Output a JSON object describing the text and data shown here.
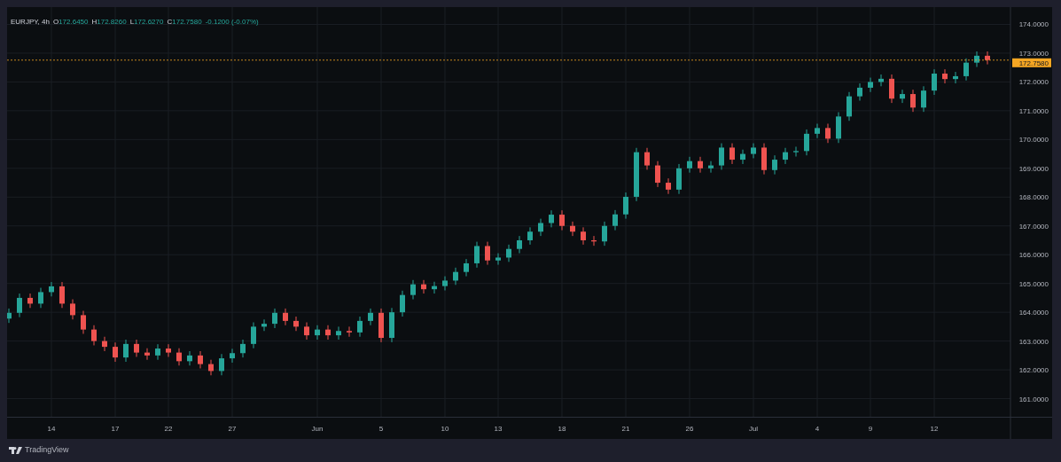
{
  "legend": {
    "symbol": "EURJPY, 4h",
    "ohlc": [
      {
        "label": "O",
        "value": "172.6450"
      },
      {
        "label": "H",
        "value": "172.8260"
      },
      {
        "label": "L",
        "value": "172.6270"
      },
      {
        "label": "C",
        "value": "172.7580"
      }
    ],
    "change": "-0.1200 (-0.07%)"
  },
  "chart": {
    "chart_data": {
      "type": "candlestick",
      "categories": [
        null,
        null,
        null,
        null,
        "14",
        null,
        null,
        null,
        null,
        null,
        "17",
        null,
        null,
        null,
        null,
        "22",
        null,
        null,
        null,
        null,
        null,
        "27",
        null,
        null,
        null,
        null,
        null,
        null,
        null,
        "Jun",
        null,
        null,
        null,
        null,
        null,
        "5",
        null,
        null,
        null,
        null,
        null,
        "10",
        null,
        null,
        null,
        null,
        "13",
        null,
        null,
        null,
        null,
        null,
        "18",
        null,
        null,
        null,
        null,
        null,
        "21",
        null,
        null,
        null,
        null,
        null,
        "26",
        null,
        null,
        null,
        null,
        null,
        "Jul",
        null,
        null,
        null,
        null,
        null,
        "4",
        null,
        null,
        null,
        null,
        "9",
        null,
        null,
        null,
        null,
        null,
        "12",
        null,
        null,
        null,
        null,
        null
      ],
      "ohlc": [
        [
          163.78,
          164.13,
          163.63,
          163.98
        ],
        [
          163.98,
          164.65,
          163.83,
          164.5
        ],
        [
          164.5,
          164.65,
          164.15,
          164.3
        ],
        [
          164.3,
          164.85,
          164.15,
          164.7
        ],
        [
          164.7,
          165.05,
          164.55,
          164.9
        ],
        [
          164.9,
          165.05,
          164.15,
          164.3
        ],
        [
          164.3,
          164.45,
          163.75,
          163.9
        ],
        [
          163.9,
          164.05,
          163.25,
          163.4
        ],
        [
          163.4,
          163.55,
          162.85,
          163.0
        ],
        [
          163.0,
          163.15,
          162.65,
          162.8
        ],
        [
          162.8,
          162.95,
          162.28,
          162.43
        ],
        [
          162.43,
          163.05,
          162.28,
          162.9
        ],
        [
          162.9,
          163.05,
          162.45,
          162.6
        ],
        [
          162.6,
          162.75,
          162.35,
          162.5
        ],
        [
          162.5,
          162.89,
          162.35,
          162.74
        ],
        [
          162.74,
          162.89,
          162.45,
          162.6
        ],
        [
          162.6,
          162.75,
          162.15,
          162.3
        ],
        [
          162.3,
          162.65,
          162.15,
          162.5
        ],
        [
          162.5,
          162.65,
          162.05,
          162.2
        ],
        [
          162.2,
          162.35,
          161.81,
          161.96
        ],
        [
          161.96,
          162.55,
          161.81,
          162.4
        ],
        [
          162.4,
          162.73,
          162.25,
          162.58
        ],
        [
          162.58,
          163.05,
          162.43,
          162.9
        ],
        [
          162.9,
          163.65,
          162.75,
          163.5
        ],
        [
          163.5,
          163.75,
          163.35,
          163.6
        ],
        [
          163.6,
          164.13,
          163.45,
          163.98
        ],
        [
          163.98,
          164.13,
          163.55,
          163.7
        ],
        [
          163.7,
          163.85,
          163.35,
          163.5
        ],
        [
          163.5,
          163.65,
          163.05,
          163.2
        ],
        [
          163.2,
          163.55,
          163.05,
          163.4
        ],
        [
          163.4,
          163.55,
          163.05,
          163.2
        ],
        [
          163.2,
          163.5,
          163.05,
          163.35
        ],
        [
          163.35,
          163.5,
          163.15,
          163.3
        ],
        [
          163.3,
          163.85,
          163.15,
          163.7
        ],
        [
          163.7,
          164.13,
          163.55,
          163.98
        ],
        [
          163.98,
          164.13,
          162.96,
          163.11
        ],
        [
          163.11,
          164.15,
          162.96,
          164.0
        ],
        [
          164.0,
          164.75,
          163.85,
          164.6
        ],
        [
          164.6,
          165.12,
          164.45,
          164.97
        ],
        [
          164.97,
          165.12,
          164.65,
          164.8
        ],
        [
          164.8,
          165.06,
          164.65,
          164.91
        ],
        [
          164.91,
          165.25,
          164.76,
          165.1
        ],
        [
          165.1,
          165.55,
          164.95,
          165.4
        ],
        [
          165.4,
          165.85,
          165.25,
          165.7
        ],
        [
          165.7,
          166.45,
          165.55,
          166.3
        ],
        [
          166.3,
          166.45,
          165.65,
          165.8
        ],
        [
          165.8,
          166.05,
          165.65,
          165.9
        ],
        [
          165.9,
          166.35,
          165.75,
          166.2
        ],
        [
          166.2,
          166.65,
          166.05,
          166.5
        ],
        [
          166.5,
          166.95,
          166.35,
          166.8
        ],
        [
          166.8,
          167.25,
          166.65,
          167.1
        ],
        [
          167.1,
          167.54,
          166.95,
          167.39
        ],
        [
          167.39,
          167.54,
          166.85,
          167.0
        ],
        [
          167.0,
          167.15,
          166.65,
          166.8
        ],
        [
          166.8,
          166.95,
          166.35,
          166.5
        ],
        [
          166.5,
          166.65,
          166.31,
          166.46
        ],
        [
          166.46,
          167.15,
          166.31,
          167.0
        ],
        [
          167.0,
          167.55,
          166.85,
          167.4
        ],
        [
          167.4,
          168.16,
          167.25,
          168.01
        ],
        [
          168.01,
          169.71,
          167.86,
          169.56
        ],
        [
          169.56,
          169.71,
          168.95,
          169.1
        ],
        [
          169.1,
          169.25,
          168.35,
          168.5
        ],
        [
          168.5,
          168.65,
          168.11,
          168.26
        ],
        [
          168.26,
          169.15,
          168.11,
          169.0
        ],
        [
          169.0,
          169.4,
          168.85,
          169.25
        ],
        [
          169.25,
          169.4,
          168.85,
          169.0
        ],
        [
          169.0,
          169.25,
          168.85,
          169.1
        ],
        [
          169.1,
          169.87,
          168.95,
          169.72
        ],
        [
          169.72,
          169.87,
          169.15,
          169.3
        ],
        [
          169.3,
          169.65,
          169.15,
          169.5
        ],
        [
          169.5,
          169.87,
          169.35,
          169.72
        ],
        [
          169.72,
          169.87,
          168.79,
          168.94
        ],
        [
          168.94,
          169.45,
          168.79,
          169.3
        ],
        [
          169.3,
          169.71,
          169.15,
          169.56
        ],
        [
          169.56,
          169.75,
          169.41,
          169.6
        ],
        [
          169.6,
          170.35,
          169.45,
          170.2
        ],
        [
          170.2,
          170.55,
          170.05,
          170.4
        ],
        [
          170.4,
          170.55,
          169.88,
          170.03
        ],
        [
          170.03,
          170.95,
          169.88,
          170.8
        ],
        [
          170.8,
          171.65,
          170.65,
          171.5
        ],
        [
          171.5,
          171.95,
          171.35,
          171.8
        ],
        [
          171.8,
          172.15,
          171.65,
          172.0
        ],
        [
          172.0,
          172.26,
          171.85,
          172.11
        ],
        [
          172.11,
          172.26,
          171.27,
          171.42
        ],
        [
          171.42,
          171.73,
          171.27,
          171.58
        ],
        [
          171.58,
          171.73,
          170.96,
          171.11
        ],
        [
          171.11,
          171.85,
          170.96,
          171.7
        ],
        [
          171.7,
          172.44,
          171.55,
          172.29
        ],
        [
          172.29,
          172.44,
          171.95,
          172.1
        ],
        [
          172.1,
          172.35,
          171.95,
          172.2
        ],
        [
          172.2,
          172.82,
          172.05,
          172.67
        ],
        [
          172.67,
          173.06,
          172.52,
          172.91
        ],
        [
          172.91,
          173.06,
          172.61,
          172.76
        ]
      ],
      "ylim": [
        159.6,
        174.6
      ],
      "yticks": [
        {
          "value": 174,
          "label": "174.0000"
        },
        {
          "value": 173,
          "label": "173.0000"
        },
        {
          "value": 172,
          "label": "172.0000"
        },
        {
          "value": 171,
          "label": "171.0000"
        },
        {
          "value": 170,
          "label": "170.0000"
        },
        {
          "value": 169,
          "label": "169.0000"
        },
        {
          "value": 168,
          "label": "168.0000"
        },
        {
          "value": 167,
          "label": "167.0000"
        },
        {
          "value": 166,
          "label": "166.0000"
        },
        {
          "value": 165,
          "label": "165.0000"
        },
        {
          "value": 164,
          "label": "164.0000"
        },
        {
          "value": 163,
          "label": "163.0000"
        },
        {
          "value": 162,
          "label": "162.0000"
        },
        {
          "value": 161,
          "label": "161.0000"
        }
      ],
      "grid": true,
      "ref_lines": [
        {
          "axis": "y",
          "value": 172.758,
          "label": "172.7580",
          "color": "#f5a623"
        }
      ]
    }
  },
  "footer": {
    "brand": "TradingView"
  }
}
